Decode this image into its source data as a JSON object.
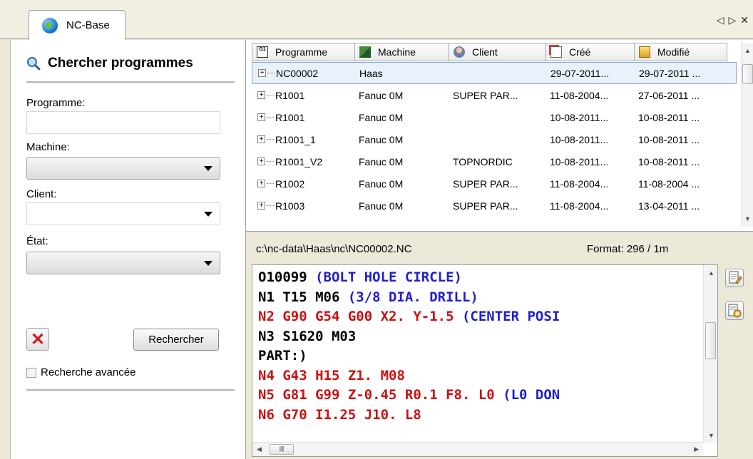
{
  "tab": {
    "title": "NC-Base",
    "controls": [
      "◁",
      "▷",
      "✕"
    ]
  },
  "search": {
    "title": "Chercher programmes",
    "programme_label": "Programme:",
    "programme_value": "",
    "machine_label": "Machine:",
    "machine_value": "",
    "client_label": "Client:",
    "client_value": "",
    "etat_label": "État:",
    "etat_value": "",
    "search_button": "Rechercher",
    "advanced_label": "Recherche avancée",
    "advanced_checked": false
  },
  "grid": {
    "columns": [
      "Programme",
      "Machine",
      "Client",
      "Créé",
      "Modifié"
    ],
    "rows": [
      {
        "programme": "NC00002",
        "machine": "Haas",
        "client": "",
        "cree": "29-07-2011...",
        "modifie": "29-07-2011 ...",
        "selected": true
      },
      {
        "programme": "R1001",
        "machine": "Fanuc 0M",
        "client": "SUPER PAR...",
        "cree": "11-08-2004...",
        "modifie": "27-06-2011 ..."
      },
      {
        "programme": "R1001",
        "machine": "Fanuc 0M",
        "client": "",
        "cree": "10-08-2011...",
        "modifie": "10-08-2011 ..."
      },
      {
        "programme": "R1001_1",
        "machine": "Fanuc 0M",
        "client": "",
        "cree": "10-08-2011...",
        "modifie": "10-08-2011 ..."
      },
      {
        "programme": "R1001_V2",
        "machine": "Fanuc 0M",
        "client": "TOPNORDIC",
        "cree": "10-08-2011...",
        "modifie": "10-08-2011 ..."
      },
      {
        "programme": "R1002",
        "machine": "Fanuc 0M",
        "client": "SUPER PAR...",
        "cree": "11-08-2004...",
        "modifie": "11-08-2004 ..."
      },
      {
        "programme": "R1003",
        "machine": "Fanuc 0M",
        "client": "SUPER PAR...",
        "cree": "11-08-2004...",
        "modifie": "13-04-2011 ..."
      }
    ]
  },
  "code": {
    "path": "c:\\nc-data\\Haas\\nc\\NC00002.NC",
    "format": "Format: 296 / 1m",
    "lines": [
      [
        {
          "t": "O10099 ",
          "c": "k"
        },
        {
          "t": "(BOLT HOLE CIRCLE)",
          "c": "b"
        }
      ],
      [
        {
          "t": "N1 T15 M06 ",
          "c": "k"
        },
        {
          "t": "(3/8 DIA. DRILL)",
          "c": "b"
        }
      ],
      [
        {
          "t": "N2 G90 G54 G00 X2. Y-1.5 ",
          "c": "r"
        },
        {
          "t": "(CENTER POSI",
          "c": "b"
        }
      ],
      [
        {
          "t": "N3 S1620 M03",
          "c": "k"
        }
      ],
      [
        {
          "t": "PART:)",
          "c": "k"
        }
      ],
      [
        {
          "t": "N4 G43 H15 Z1. M08",
          "c": "r"
        }
      ],
      [
        {
          "t": "N5 G81 G99 Z-0.45 R0.1 F8. L0 ",
          "c": "r"
        },
        {
          "t": "(L0 DON",
          "c": "b"
        }
      ],
      [
        {
          "t": "N6 G70 I1.25 J10. L8",
          "c": "r"
        }
      ]
    ]
  },
  "colors": {
    "code_black": "#000000",
    "code_red": "#cc1010",
    "code_blue": "#2020d0",
    "selection": "#e9f1fb"
  }
}
